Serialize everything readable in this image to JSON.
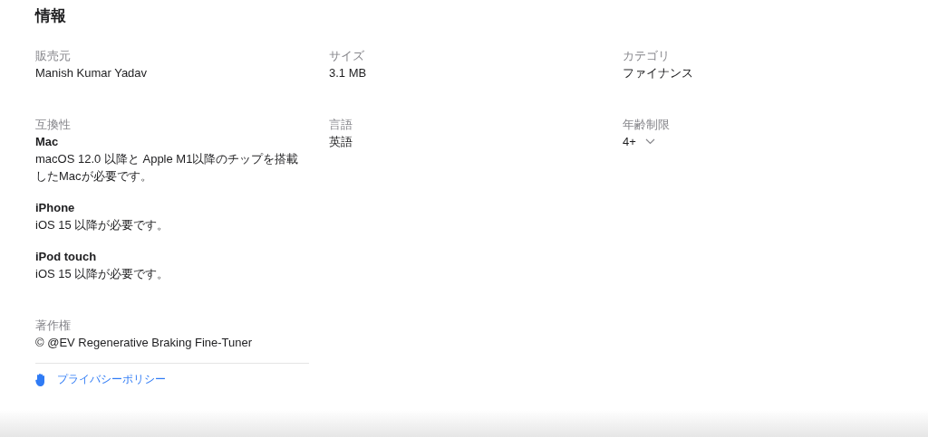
{
  "title": "情報",
  "fields": [
    {
      "kind": "text",
      "label": "販売元",
      "value": "Manish Kumar Yadav"
    },
    {
      "kind": "text",
      "label": "サイズ",
      "value": "3.1 MB"
    },
    {
      "kind": "text",
      "label": "カテゴリ",
      "value": "ファイナンス"
    },
    {
      "kind": "compat",
      "label": "互換性",
      "devices": [
        {
          "name": "Mac",
          "requirement": "macOS 12.0 以降と Apple M1以降のチップを搭載したMacが必要です。"
        },
        {
          "name": "iPhone",
          "requirement": "iOS 15 以降が必要です。"
        },
        {
          "name": "iPod touch",
          "requirement": "iOS 15 以降が必要です。"
        }
      ]
    },
    {
      "kind": "text",
      "label": "言語",
      "value": "英語"
    },
    {
      "kind": "rating",
      "label": "年齢制限",
      "value": "4+",
      "expanded": false
    }
  ],
  "copyright": {
    "label": "著作権",
    "value": "© @EV Regenerative Braking Fine-Tuner"
  },
  "privacy_link": "プライバシーポリシー"
}
